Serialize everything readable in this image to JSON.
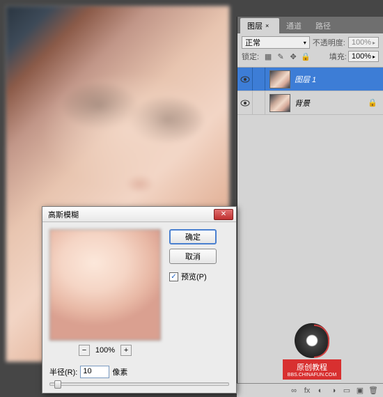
{
  "panel": {
    "tabs": [
      {
        "label": "图层",
        "active": true
      },
      {
        "label": "通道",
        "active": false
      },
      {
        "label": "路径",
        "active": false
      }
    ],
    "blend_mode": "正常",
    "opacity_label": "不透明度:",
    "opacity_value": "100%",
    "lock_label": "锁定:",
    "fill_label": "填充:",
    "fill_value": "100%"
  },
  "layers": [
    {
      "name": "图层 1",
      "selected": true,
      "locked": false
    },
    {
      "name": "背景",
      "selected": false,
      "locked": true
    }
  ],
  "dialog": {
    "title": "高斯模糊",
    "ok": "确定",
    "cancel": "取消",
    "preview_label": "预览(P)",
    "zoom": "100%",
    "radius_label": "半径(R):",
    "radius_value": "10",
    "radius_unit": "像素"
  },
  "watermark": {
    "line1": "原创教程",
    "line2": "BBS.CHINAFUN.COM"
  }
}
